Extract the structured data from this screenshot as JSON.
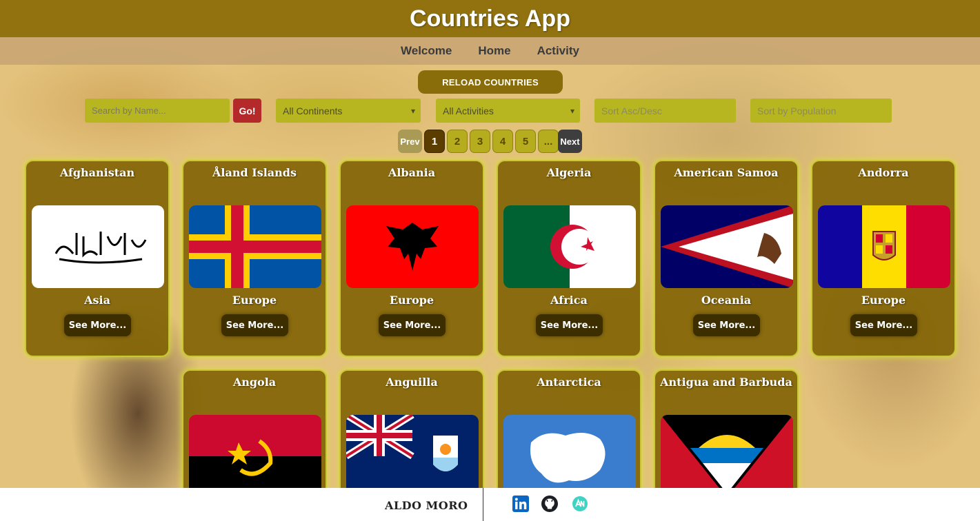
{
  "header": {
    "title": "Countries App"
  },
  "nav": {
    "items": [
      "Welcome",
      "Home",
      "Activity"
    ]
  },
  "controls": {
    "reload_label": "RELOAD COUNTRIES",
    "search_placeholder": "Search by Name...",
    "go_label": "Go!",
    "continent_select": "All Continents",
    "activity_select": "All Activities",
    "sort_order": "Sort Asc/Desc",
    "sort_population": "Sort by Population"
  },
  "pagination": {
    "prev": "Prev",
    "pages": [
      "1",
      "2",
      "3",
      "4",
      "5",
      "..."
    ],
    "active": "1",
    "next": "Next"
  },
  "cards": [
    {
      "name": "Afghanistan",
      "continent": "Asia",
      "button": "See More..."
    },
    {
      "name": "Åland Islands",
      "continent": "Europe",
      "button": "See More..."
    },
    {
      "name": "Albania",
      "continent": "Europe",
      "button": "See More..."
    },
    {
      "name": "Algeria",
      "continent": "Africa",
      "button": "See More..."
    },
    {
      "name": "American Samoa",
      "continent": "Oceania",
      "button": "See More..."
    },
    {
      "name": "Andorra",
      "continent": "Europe",
      "button": "See More..."
    },
    {
      "name": "Angola"
    },
    {
      "name": "Anguilla"
    },
    {
      "name": "Antarctica"
    },
    {
      "name": "Antigua and Barbuda"
    }
  ],
  "footer": {
    "author": "ALDO MORO",
    "icons": [
      "linkedin-icon",
      "github-icon",
      "portfolio-icon"
    ]
  },
  "colors": {
    "header": "#8c6e0a",
    "nav": "#c8a573",
    "card": "#826405",
    "card_border": "#c8c835",
    "filter": "#b8b620",
    "go": "#b42a2a"
  }
}
